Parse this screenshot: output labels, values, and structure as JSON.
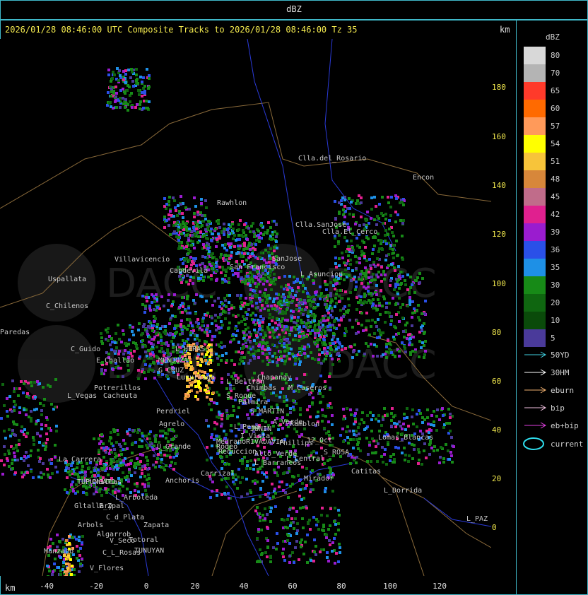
{
  "header": {
    "label": "dBZ"
  },
  "plot": {
    "title": "2026/01/28 08:46:00 UTC Composite Tracks to 2026/01/28 08:46:00 Tz 35",
    "unit_top": "km",
    "unit_bottom": "km",
    "watermark": "DACC"
  },
  "y_ticks": [
    "180",
    "160",
    "140",
    "120",
    "100",
    "80",
    "60",
    "40",
    "20",
    "0"
  ],
  "x_ticks": [
    "-40",
    "-20",
    "0",
    "20",
    "40",
    "60",
    "80",
    "100",
    "120"
  ],
  "legend": {
    "title": "dBZ",
    "scale": [
      {
        "label": "80",
        "color": "#d8d8d8"
      },
      {
        "label": "70",
        "color": "#b4b4b4"
      },
      {
        "label": "65",
        "color": "#ff3a2a"
      },
      {
        "label": "60",
        "color": "#ff6a00"
      },
      {
        "label": "57",
        "color": "#ff9a5a"
      },
      {
        "label": "54",
        "color": "#ffff00"
      },
      {
        "label": "51",
        "color": "#f7c43a"
      },
      {
        "label": "48",
        "color": "#d7873a"
      },
      {
        "label": "45",
        "color": "#c06c8a"
      },
      {
        "label": "42",
        "color": "#e0208f"
      },
      {
        "label": "39",
        "color": "#9a1ccf"
      },
      {
        "label": "36",
        "color": "#2a50e8"
      },
      {
        "label": "35",
        "color": "#1e90e6"
      },
      {
        "label": "30",
        "color": "#178a17"
      },
      {
        "label": "20",
        "color": "#0f6610"
      },
      {
        "label": "10",
        "color": "#0a4a0a"
      },
      {
        "label": "5",
        "color": "#4a3a9a"
      }
    ],
    "tracks": [
      {
        "label": "50YD",
        "color": "#40d0e0"
      },
      {
        "label": "30HM",
        "color": "#ffffff"
      },
      {
        "label": "eburn",
        "color": "#f0b070"
      },
      {
        "label": "bip",
        "color": "#f0c0e0"
      },
      {
        "label": "eb+bip",
        "color": "#e040e0"
      }
    ],
    "current": {
      "label": "current",
      "color": "#30e0f0"
    }
  },
  "places": [
    {
      "name": "Clla.del_Rosario"
    },
    {
      "name": "Encon"
    },
    {
      "name": "Rawhlon"
    },
    {
      "name": "Clla.SanJose"
    },
    {
      "name": "Clla.El_Cerco"
    },
    {
      "name": "Villavicencio"
    },
    {
      "name": "Capdevila"
    },
    {
      "name": "San Francisco"
    },
    {
      "name": "SanJose"
    },
    {
      "name": "L_Asuncion"
    },
    {
      "name": "Uspallata"
    },
    {
      "name": "C_Chilenos"
    },
    {
      "name": "Paredas"
    },
    {
      "name": "C_Guido"
    },
    {
      "name": "E_Challao"
    },
    {
      "name": "MENDOZA"
    },
    {
      "name": "L_HERAS"
    },
    {
      "name": "G_CRUZ"
    },
    {
      "name": "Luzuriaga"
    },
    {
      "name": "Potrerillos"
    },
    {
      "name": "L_Vegas"
    },
    {
      "name": "Cacheuta"
    },
    {
      "name": "L_Beltran"
    },
    {
      "name": "Chimbas"
    },
    {
      "name": "Chapanay"
    },
    {
      "name": "M_Caseros"
    },
    {
      "name": "S_Roque"
    },
    {
      "name": "Palmira"
    },
    {
      "name": "S_MARTIN"
    },
    {
      "name": "A_Verde"
    },
    {
      "name": "Ramblon"
    },
    {
      "name": "Perdriel"
    },
    {
      "name": "Agrelo"
    },
    {
      "name": "U_Grande"
    },
    {
      "name": "Rodeo"
    },
    {
      "name": "L_Pena"
    },
    {
      "name": "JUNIN"
    },
    {
      "name": "RIVADAVIA"
    },
    {
      "name": "Phillips"
    },
    {
      "name": "12_Oct"
    },
    {
      "name": "S_ROSA"
    },
    {
      "name": "Lomas_Blancas"
    },
    {
      "name": "La_Carrera"
    },
    {
      "name": "Reduccion"
    },
    {
      "name": "Medrano"
    },
    {
      "name": "L_Barrancos"
    },
    {
      "name": "Alto_Verde"
    },
    {
      "name": "L_Central"
    },
    {
      "name": "Catitas"
    },
    {
      "name": "Carrizal"
    },
    {
      "name": "Mirador"
    },
    {
      "name": "L_Dorrida"
    },
    {
      "name": "TUPUNGATO"
    },
    {
      "name": "Anchoris"
    },
    {
      "name": "Chilcas"
    },
    {
      "name": "L_Arboleda"
    },
    {
      "name": "Gltallary"
    },
    {
      "name": "E_Zpal"
    },
    {
      "name": "Arbols"
    },
    {
      "name": "C_d_Plata"
    },
    {
      "name": "Zapata"
    },
    {
      "name": "Algarrob"
    },
    {
      "name": "V_Seco"
    },
    {
      "name": "Totoral"
    },
    {
      "name": "C_L_Rosas"
    },
    {
      "name": "TUNUYAN"
    },
    {
      "name": "Manzano"
    },
    {
      "name": "V_Flores"
    },
    {
      "name": "L_PAZ"
    },
    {
      "name": "I_Vista"
    }
  ]
}
